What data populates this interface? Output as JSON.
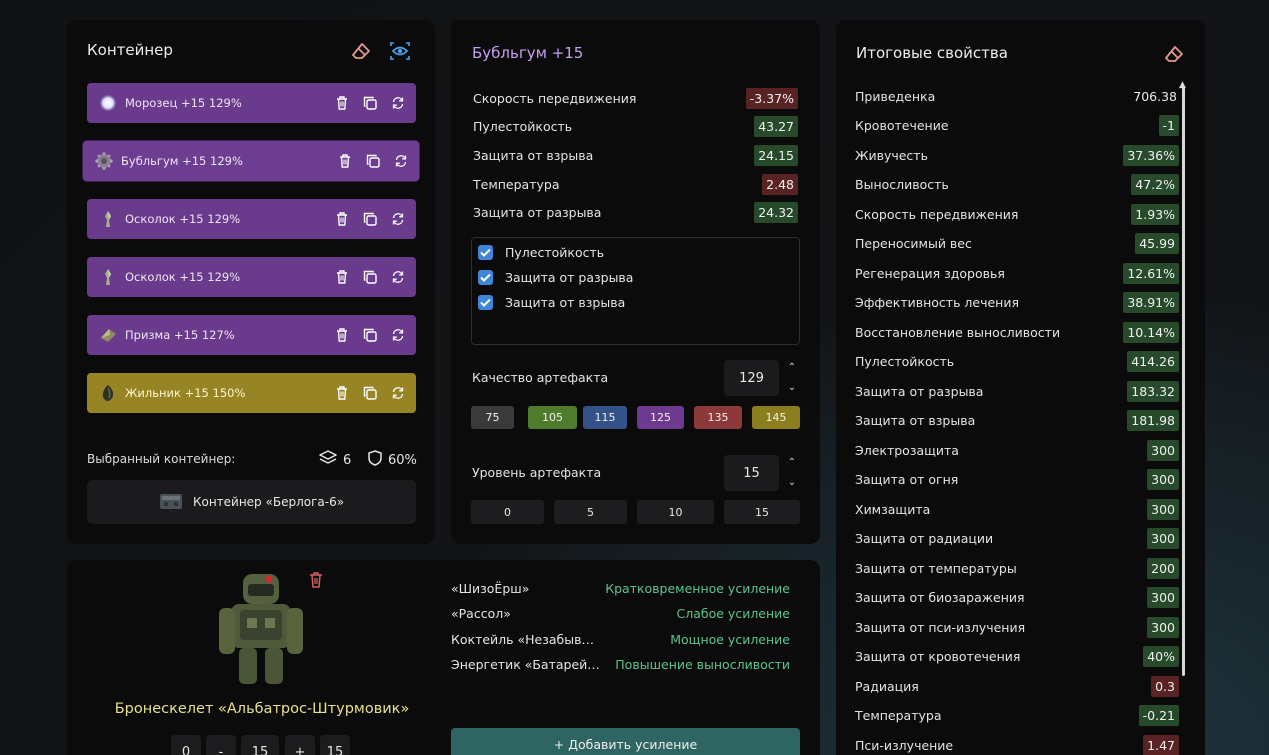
{
  "container": {
    "title": "Контейнер",
    "items": [
      {
        "name": "Морозец",
        "level": "+15",
        "quality": "129%",
        "icon": "frost-orb-icon",
        "color": "purple"
      },
      {
        "name": "Бубльгум",
        "level": "+15",
        "quality": "129%",
        "icon": "gear-orb-icon",
        "color": "purple"
      },
      {
        "name": "Осколок",
        "level": "+15",
        "quality": "129%",
        "icon": "shard-icon",
        "color": "purple"
      },
      {
        "name": "Осколок",
        "level": "+15",
        "quality": "129%",
        "icon": "shard-icon",
        "color": "purple"
      },
      {
        "name": "Призма",
        "level": "+15",
        "quality": "127%",
        "icon": "prism-icon",
        "color": "purple"
      },
      {
        "name": "Жильник",
        "level": "+15",
        "quality": "150%",
        "icon": "vein-rock-icon",
        "color": "gold"
      }
    ],
    "selected_label": "Выбранный контейнер:",
    "slots": "6",
    "protection": "60%",
    "container_name": "Контейнер «Берлога-6»"
  },
  "artifact": {
    "title": "Бубльгум +15",
    "stats": [
      {
        "name": "Скорость передвижения",
        "value": "-3.37%",
        "tone": "negative"
      },
      {
        "name": "Пулестойкость",
        "value": "43.27",
        "tone": "positive"
      },
      {
        "name": "Защита от взрыва",
        "value": "24.15",
        "tone": "positive"
      },
      {
        "name": "Температура",
        "value": "2.48",
        "tone": "negative"
      },
      {
        "name": "Защита от разрыва",
        "value": "24.32",
        "tone": "positive"
      }
    ],
    "checked": [
      "Пулестойкость",
      "Защита от разрыва",
      "Защита от взрыва"
    ],
    "quality_label": "Качество артефакта",
    "quality_value": "129",
    "quality_presets": [
      {
        "label": "75",
        "color": "#3a3a3c"
      },
      {
        "label": "105",
        "color": "#4e7c2c"
      },
      {
        "label": "115",
        "color": "#34528a"
      },
      {
        "label": "125",
        "color": "#6c3a8e"
      },
      {
        "label": "135",
        "color": "#8e3939"
      },
      {
        "label": "145",
        "color": "#8c7d1f"
      }
    ],
    "level_label": "Уровень артефакта",
    "level_value": "15",
    "level_presets": [
      "0",
      "5",
      "10",
      "15"
    ]
  },
  "totals": {
    "title": "Итоговые свойства",
    "props": [
      {
        "name": "Приведенка",
        "value": "706.38",
        "tone": "plain"
      },
      {
        "name": "Кровотечение",
        "value": "-1",
        "tone": "positive"
      },
      {
        "name": "Живучесть",
        "value": "37.36%",
        "tone": "positive"
      },
      {
        "name": "Выносливость",
        "value": "47.2%",
        "tone": "positive"
      },
      {
        "name": "Скорость передвижения",
        "value": "1.93%",
        "tone": "positive"
      },
      {
        "name": "Переносимый вес",
        "value": "45.99",
        "tone": "positive"
      },
      {
        "name": "Регенерация здоровья",
        "value": "12.61%",
        "tone": "positive"
      },
      {
        "name": "Эффективность лечения",
        "value": "38.91%",
        "tone": "positive"
      },
      {
        "name": "Восстановление выносливости",
        "value": "10.14%",
        "tone": "positive"
      },
      {
        "name": "Пулестойкость",
        "value": "414.26",
        "tone": "positive"
      },
      {
        "name": "Защита от разрыва",
        "value": "183.32",
        "tone": "positive"
      },
      {
        "name": "Защита от взрыва",
        "value": "181.98",
        "tone": "positive"
      },
      {
        "name": "Электрозащита",
        "value": "300",
        "tone": "positive"
      },
      {
        "name": "Защита от огня",
        "value": "300",
        "tone": "positive"
      },
      {
        "name": "Химзащита",
        "value": "300",
        "tone": "positive"
      },
      {
        "name": "Защита от радиации",
        "value": "300",
        "tone": "positive"
      },
      {
        "name": "Защита от температуры",
        "value": "200",
        "tone": "positive"
      },
      {
        "name": "Защита от биозаражения",
        "value": "300",
        "tone": "positive"
      },
      {
        "name": "Защита от пси-излучения",
        "value": "300",
        "tone": "positive"
      },
      {
        "name": "Защита от кровотечения",
        "value": "40%",
        "tone": "positive"
      },
      {
        "name": "Радиация",
        "value": "0.3",
        "tone": "negative"
      },
      {
        "name": "Температура",
        "value": "-0.21",
        "tone": "positive"
      },
      {
        "name": "Пси-излучение",
        "value": "1.47",
        "tone": "negative"
      }
    ]
  },
  "suit": {
    "name": "Бронескелет «Альбатрос-Штурмовик»",
    "boosts": [
      {
        "name": "«ШизоЁрш»",
        "type": "Кратковременное усиление"
      },
      {
        "name": "«Рассол»",
        "type": "Слабое усиление"
      },
      {
        "name": "Коктейль «Незабываемый»",
        "type": "Мощное усиление"
      },
      {
        "name": "Энергетик «Батарейка»",
        "type": "Повышение выносливости"
      }
    ],
    "add_label": "+ Добавить усиление",
    "controls": [
      "0",
      "-",
      "15",
      "+",
      "15"
    ]
  },
  "colors": {
    "purple": "#6a3a8c",
    "gold": "#968425",
    "positive": "#264a2a",
    "negative": "#5a2323",
    "accent_title": "#c79ff0",
    "boost_green": "#5dc58c",
    "suit_name": "#e9e08a"
  }
}
